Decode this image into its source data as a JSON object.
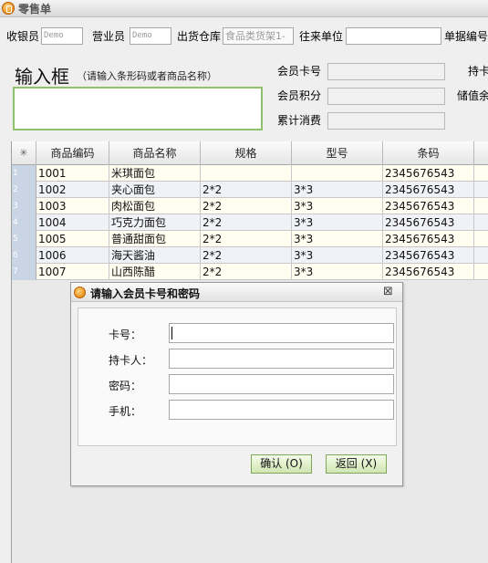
{
  "window": {
    "title": "零售单",
    "app_icon": "app-logo-icon"
  },
  "header": {
    "cashier_label": "收银员",
    "cashier_value": "Demo",
    "salesperson_label": "营业员",
    "salesperson_value": "Demo",
    "warehouse_label": "出货仓库",
    "warehouse_value": "食品类货架1-",
    "partner_label": "往来单位",
    "partner_value": "",
    "doc_no_label": "单据编号"
  },
  "input_area": {
    "title": "输入框",
    "hint": "（请输入条形码或者商品名称）",
    "value": ""
  },
  "member": {
    "card_label": "会员卡号",
    "card_value": "",
    "holder_label": "持卡",
    "points_label": "会员积分",
    "points_value": "",
    "balance_label": "储值余",
    "total_label": "累计消费",
    "total_value": ""
  },
  "table": {
    "columns": [
      "商品编码",
      "商品名称",
      "规格",
      "型号",
      "条码"
    ],
    "corner_icon": "asterisk-icon",
    "rows": [
      {
        "no": "1",
        "code": "1001",
        "name": "米琪面包",
        "spec": "",
        "model": "",
        "barcode": "2345676543"
      },
      {
        "no": "2",
        "code": "1002",
        "name": "夹心面包",
        "spec": "2*2",
        "model": "3*3",
        "barcode": "2345676543"
      },
      {
        "no": "3",
        "code": "1003",
        "name": "肉松面包",
        "spec": "2*2",
        "model": "3*3",
        "barcode": "2345676543"
      },
      {
        "no": "4",
        "code": "1004",
        "name": "巧克力面包",
        "spec": "2*2",
        "model": "3*3",
        "barcode": "2345676543"
      },
      {
        "no": "5",
        "code": "1005",
        "name": "普通甜面包",
        "spec": "2*2",
        "model": "3*3",
        "barcode": "2345676543"
      },
      {
        "no": "6",
        "code": "1006",
        "name": "海天酱油",
        "spec": "2*2",
        "model": "3*3",
        "barcode": "2345676543"
      },
      {
        "no": "7",
        "code": "1007",
        "name": "山西陈醋",
        "spec": "2*2",
        "model": "3*3",
        "barcode": "2345676543"
      }
    ]
  },
  "dialog": {
    "title": "请输入会员卡号和密码",
    "close_icon": "close-icon",
    "fields": [
      {
        "label": "卡号：",
        "value": ""
      },
      {
        "label": "持卡人：",
        "value": ""
      },
      {
        "label": "密码：",
        "value": ""
      },
      {
        "label": "手机：",
        "value": ""
      }
    ],
    "confirm_label": "确认 (O)",
    "cancel_label": "返回 (X)"
  },
  "colors": {
    "input_border": "#8fc06c",
    "row_even": "#fffef0",
    "row_odd": "#f0f2f8",
    "button_bg": "#cfe6b1",
    "row_number_bg": "#c9d4e4"
  }
}
